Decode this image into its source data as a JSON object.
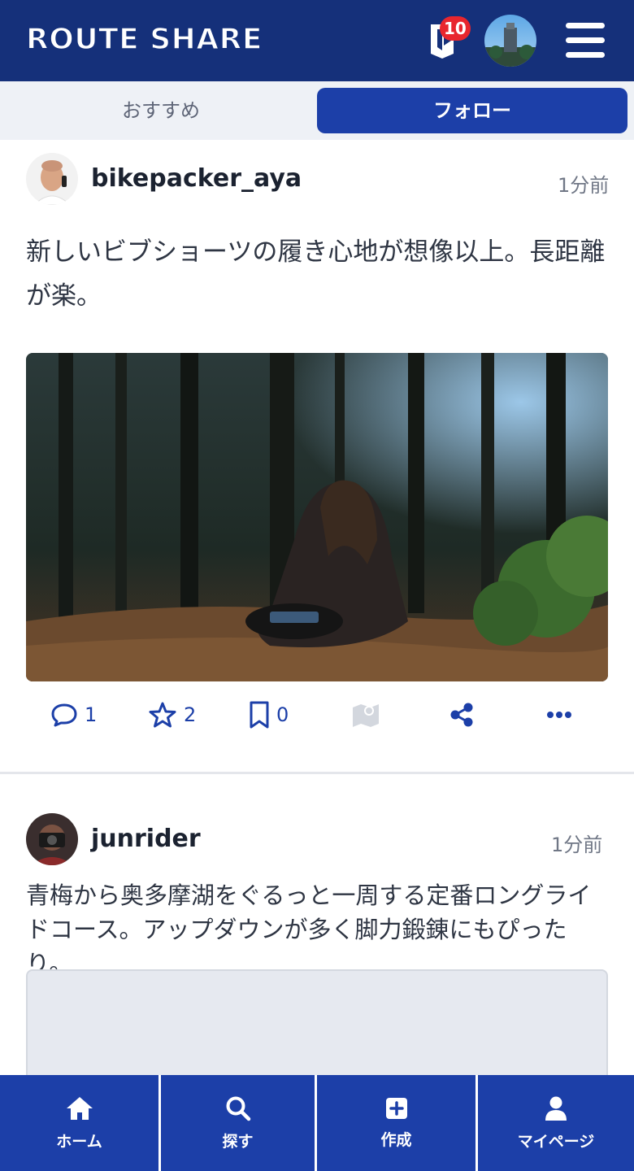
{
  "header": {
    "logo": "ROUTE SHARE",
    "notification_count": "10",
    "icons": {
      "notification": "bookmark-bell-icon",
      "menu": "hamburger-menu-icon"
    }
  },
  "tabs": [
    {
      "label": "おすすめ",
      "active": false
    },
    {
      "label": "フォロー",
      "active": true
    }
  ],
  "posts": [
    {
      "username": "bikepacker_aya",
      "time": "1分前",
      "text": "新しいビブショーツの履き心地が想像以上。長距離が楽。",
      "actions": {
        "comments": "1",
        "favorites": "2",
        "bookmarks": "0"
      }
    },
    {
      "username": "junrider",
      "time": "1分前",
      "text": "青梅から奥多摩湖をぐるっと一周する定番ロングライドコース。アップダウンが多く脚力鍛錬にもぴったり。"
    }
  ],
  "bottom_nav": [
    {
      "label": "ホーム",
      "icon": "home-icon"
    },
    {
      "label": "探す",
      "icon": "search-icon"
    },
    {
      "label": "作成",
      "icon": "plus-square-icon"
    },
    {
      "label": "マイページ",
      "icon": "user-icon"
    }
  ],
  "colors": {
    "header": "#15307a",
    "accent": "#1c3fa8",
    "badge": "#e8262e",
    "tab_bg": "#eef1f6"
  }
}
